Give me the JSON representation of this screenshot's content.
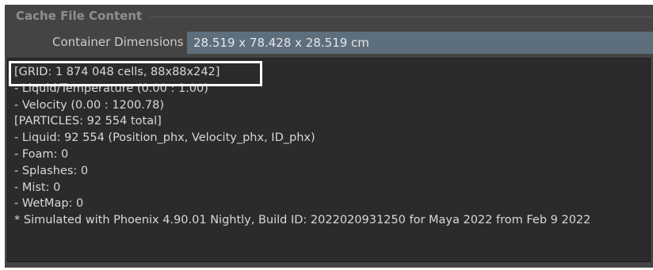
{
  "section": {
    "title": "Cache File Content"
  },
  "container": {
    "label": "Container Dimensions",
    "value": "28.519 x 78.428 x 28.519 cm"
  },
  "content": {
    "lines": [
      "[GRID: 1 874 048 cells, 88x88x242]",
      "- Liquid/Temperature (0.00 : 1.00)",
      "- Velocity (0.00 : 1200.78)",
      "[PARTICLES: 92 554 total]",
      "- Liquid: 92 554 (Position_phx, Velocity_phx, ID_phx)",
      "- Foam: 0",
      "- Splashes: 0",
      "- Mist: 0",
      "- WetMap: 0",
      "* Simulated with Phoenix 4.90.01 Nightly, Build ID: 2022020931250 for Maya 2022 from Feb  9 2022"
    ]
  },
  "colors": {
    "panel_bg": "#444444",
    "field_bg": "#5d6f7d",
    "content_bg": "#2b2b2b",
    "highlight": "#ffffff"
  }
}
